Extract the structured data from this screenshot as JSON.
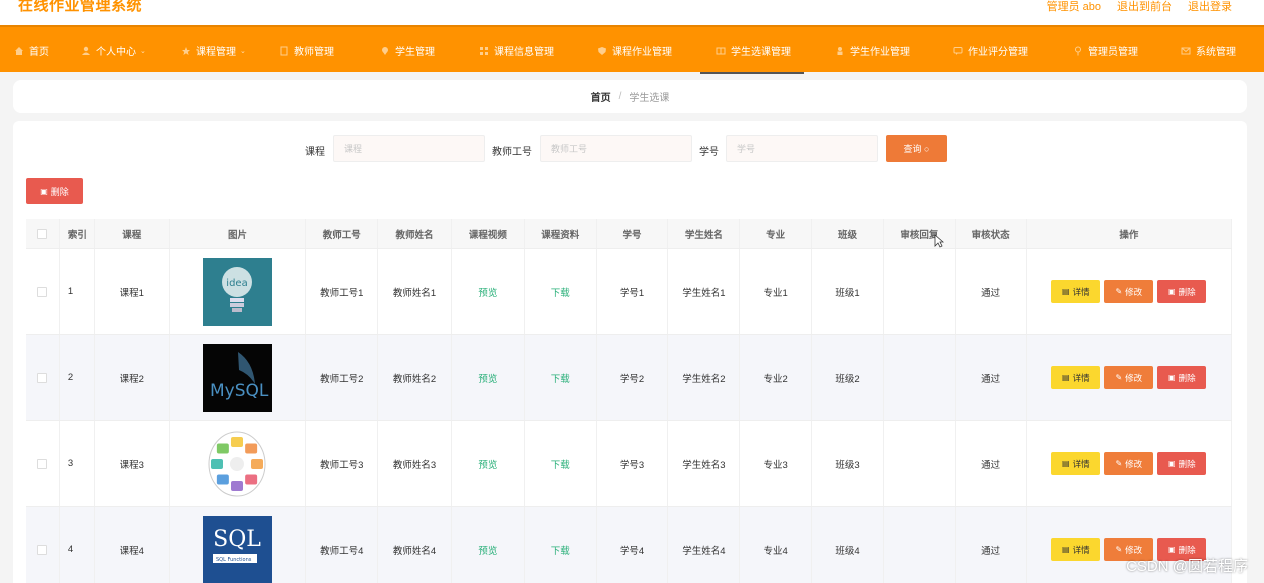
{
  "app": {
    "title": "在线作业管理系统",
    "user_label": "管理员 abo",
    "back_label": "退出到前台",
    "logout_label": "退出登录"
  },
  "nav": [
    {
      "label": "首页",
      "icon": "home-icon",
      "dropdown": false
    },
    {
      "label": "个人中心",
      "icon": "user-icon",
      "dropdown": true
    },
    {
      "label": "课程管理",
      "icon": "star-icon",
      "dropdown": true
    },
    {
      "label": "教师管理",
      "icon": "doc-icon",
      "dropdown": false
    },
    {
      "label": "学生管理",
      "icon": "pin-icon",
      "dropdown": false
    },
    {
      "label": "课程信息管理",
      "icon": "grid-icon",
      "dropdown": false
    },
    {
      "label": "课程作业管理",
      "icon": "shield-icon",
      "dropdown": false
    },
    {
      "label": "学生选课管理",
      "icon": "book-icon",
      "dropdown": false,
      "active": true
    },
    {
      "label": "学生作业管理",
      "icon": "person-icon",
      "dropdown": false
    },
    {
      "label": "作业评分管理",
      "icon": "chat-icon",
      "dropdown": false
    },
    {
      "label": "管理员管理",
      "icon": "location-icon",
      "dropdown": false
    },
    {
      "label": "系统管理",
      "icon": "mail-icon",
      "dropdown": false
    }
  ],
  "breadcrumb": {
    "home": "首页",
    "separator": "/",
    "current": "学生选课"
  },
  "search": {
    "course_label": "课程",
    "course_placeholder": "课程",
    "teacher_label": "教师工号",
    "teacher_placeholder": "教师工号",
    "student_label": "学号",
    "student_placeholder": "学号",
    "query_label": "查询"
  },
  "batch_delete_label": "删除",
  "table": {
    "headers": [
      "索引",
      "课程",
      "图片",
      "教师工号",
      "教师姓名",
      "课程视频",
      "课程资料",
      "学号",
      "学生姓名",
      "专业",
      "班级",
      "审核回复",
      "审核状态",
      "操作"
    ],
    "rows": [
      {
        "index": "1",
        "course": "课程1",
        "image": "idea-logo",
        "teacher_no": "教师工号1",
        "teacher_name": "教师姓名1",
        "video": "预览",
        "material": "下载",
        "student_no": "学号1",
        "student_name": "学生姓名1",
        "major": "专业1",
        "class": "班级1",
        "reply": "",
        "status": "通过"
      },
      {
        "index": "2",
        "course": "课程2",
        "image": "mysql-logo",
        "teacher_no": "教师工号2",
        "teacher_name": "教师姓名2",
        "video": "预览",
        "material": "下载",
        "student_no": "学号2",
        "student_name": "学生姓名2",
        "major": "专业2",
        "class": "班级2",
        "reply": "",
        "status": "通过"
      },
      {
        "index": "3",
        "course": "课程3",
        "image": "process-diagram",
        "teacher_no": "教师工号3",
        "teacher_name": "教师姓名3",
        "video": "预览",
        "material": "下载",
        "student_no": "学号3",
        "student_name": "学生姓名3",
        "major": "专业3",
        "class": "班级3",
        "reply": "",
        "status": "通过"
      },
      {
        "index": "4",
        "course": "课程4",
        "image": "sql-functions",
        "teacher_no": "教师工号4",
        "teacher_name": "教师姓名4",
        "video": "预览",
        "material": "下载",
        "student_no": "学号4",
        "student_name": "学生姓名4",
        "major": "专业4",
        "class": "班级4",
        "reply": "",
        "status": "通过"
      }
    ],
    "actions": {
      "detail": "详情",
      "edit": "修改",
      "delete": "删除"
    },
    "image_text": {
      "mysql": "MySQL",
      "sql": "SQL",
      "sql_sub": "SQL Functions",
      "idea": "idea"
    }
  },
  "watermark": "CSDN @圆若程序",
  "colors": {
    "primary": "#ff9200",
    "query": "#ee7a37",
    "danger": "#e85a4f",
    "warning": "#fbd72e",
    "link": "#2bb07a"
  }
}
